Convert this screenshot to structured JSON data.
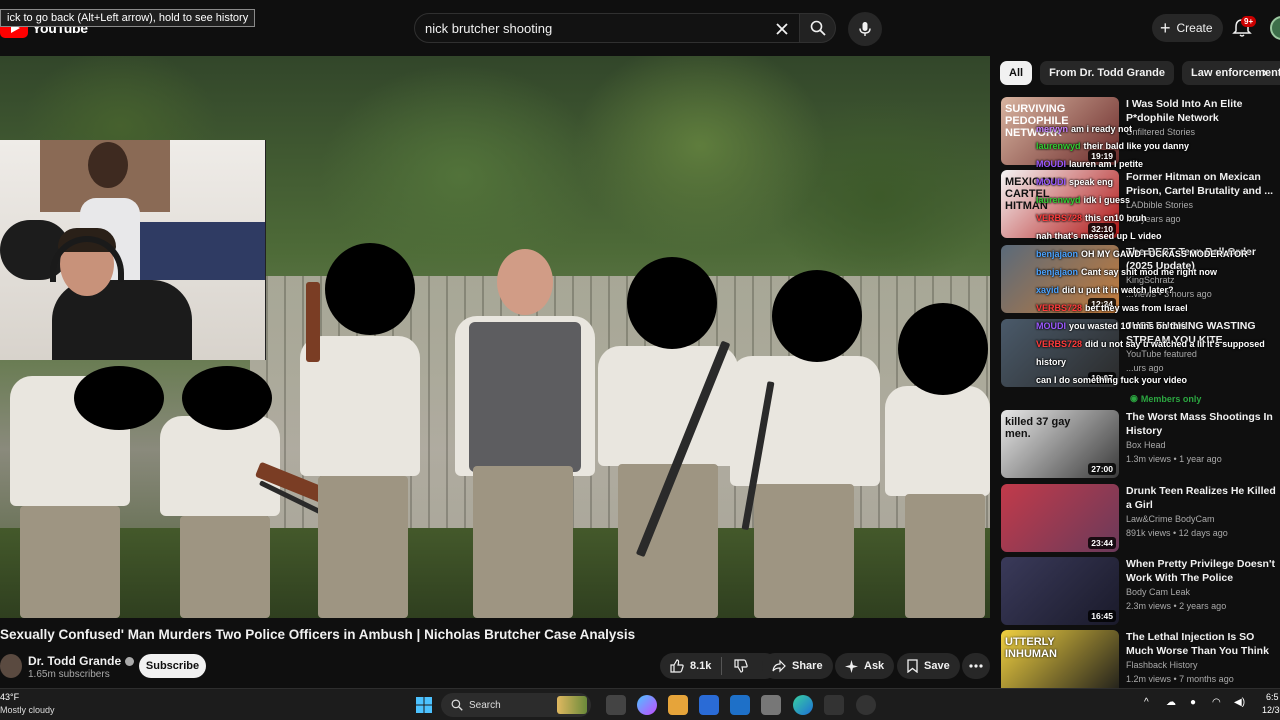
{
  "browser": {
    "back_tooltip": "ick to go back (Alt+Left arrow), hold to see history"
  },
  "header": {
    "logo_text": "YouTube",
    "search": {
      "value": "nick brutcher shooting",
      "placeholder": "Search"
    },
    "create_label": "Create",
    "notification_count": "9+"
  },
  "video": {
    "title": "Sexually Confused' Man Murders Two Police Officers in Ambush | Nicholas Brutcher Case Analysis",
    "channel": "Dr. Todd Grande",
    "subscribers": "1.65m subscribers",
    "subscribe_label": "Subscribe",
    "like_count": "8.1k",
    "share_label": "Share",
    "ask_label": "Ask",
    "save_label": "Save"
  },
  "chips": [
    "All",
    "From Dr. Todd Grande",
    "Law enforcement"
  ],
  "recommendations": [
    {
      "title": "I Was Sold Into An Elite P*dophile Network",
      "channel": "Unfiltered Stories",
      "meta": "",
      "duration": "19:19",
      "thumb_text": "SURVIVING PEDOPHILE NETWORK",
      "colors": [
        "#d8b4a0",
        "#6b2a2a"
      ]
    },
    {
      "title": "Former Hitman on Mexican Prison, Cartel Brutality and ...",
      "channel": "LADbible Stories",
      "meta": "...2 years ago",
      "duration": "32:10",
      "thumb_text": "MEXICAN CARTEL HITMAN",
      "colors": [
        "#f5f5f5",
        "#b01212"
      ]
    },
    {
      "title": "The BEST Teen Ball Order (2025 Update)",
      "channel": "KingSchratz",
      "meta": "...views • 3 hours ago",
      "duration": "12:34",
      "thumb_text": "",
      "colors": [
        "#5a6a7a",
        "#c47b3a"
      ]
    },
    {
      "title": "JUST FUCKING WASTING STREAM YOU KITE",
      "channel": "YouTube featured",
      "meta": "...urs ago",
      "duration": "10:07",
      "thumb_text": "",
      "colors": [
        "#4a5a6a",
        "#2a2a2a"
      ]
    },
    {
      "title": "The Worst Mass Shootings In History",
      "channel": "Box Head",
      "meta": "1.3m views • 1 year ago",
      "duration": "27:00",
      "thumb_text": "killed 37 gay men.",
      "colors": [
        "#e8e8e8",
        "#3a3a3a"
      ]
    },
    {
      "title": "Drunk Teen Realizes He Killed a Girl",
      "channel": "Law&Crime BodyCam",
      "meta": "891k views • 12 days ago",
      "duration": "23:44",
      "thumb_text": "",
      "colors": [
        "#c23a4a",
        "#6a3a5a"
      ]
    },
    {
      "title": "When Pretty Privilege Doesn't Work With The Police",
      "channel": "Body Cam Leak",
      "meta": "2.3m views • 2 years ago",
      "duration": "16:45",
      "thumb_text": "",
      "colors": [
        "#3a3a5a",
        "#1a1a2a"
      ]
    },
    {
      "title": "The Lethal Injection Is SO Much Worse Than You Think",
      "channel": "Flashback History",
      "meta": "1.2m views • 7 months ago",
      "duration": "",
      "thumb_text": "UTTERLY INHUMAN",
      "colors": [
        "#f0d040",
        "#1a1a1a"
      ]
    }
  ],
  "members_only": "Members only",
  "chat": [
    {
      "user": "mervyn",
      "text": "am i ready not",
      "color": "#c77dff"
    },
    {
      "user": "laurenwyd",
      "text": "their bald like you danny",
      "color": "#32cd32"
    },
    {
      "user": "MOUDI",
      "text": "lauren am I petite",
      "color": "#9b59ff"
    },
    {
      "user": "MOUDI",
      "text": "speak eng",
      "color": "#9b59ff"
    },
    {
      "user": "laurenwyd",
      "text": "idk i guess",
      "color": "#32cd32"
    },
    {
      "user": "VERBS728",
      "text": "this cn10 bruh",
      "color": "#ff3b3b"
    },
    {
      "user": "",
      "text": "nah that's messed up L video",
      "color": "#ffffff"
    },
    {
      "user": "benjajaon",
      "text": "OH MY GAWD FUCKASS MODERATOR",
      "color": "#4aa3ff"
    },
    {
      "user": "benjajaon",
      "text": "Cant say shit mod me right now",
      "color": "#4aa3ff"
    },
    {
      "user": "xayid",
      "text": "did u put it in watch later?",
      "color": "#4aa3ff"
    },
    {
      "user": "VERBS728",
      "text": "bet they was from Israel",
      "color": "#ff3b3b"
    },
    {
      "user": "MOUDI",
      "text": "you wasted 10 mins on this",
      "color": "#9b59ff"
    },
    {
      "user": "VERBS728",
      "text": "did u not say u watched a lil It's supposed",
      "color": "#ff3b3b"
    },
    {
      "user": "",
      "text": "history",
      "color": "#ffffff"
    },
    {
      "user": "",
      "text": "can I do something fuck your video",
      "color": "#ffffff"
    }
  ],
  "taskbar": {
    "temp": "43°F",
    "weather": "Mostly cloudy",
    "search_label": "Search",
    "time": "6:5",
    "date": "12/30/"
  }
}
